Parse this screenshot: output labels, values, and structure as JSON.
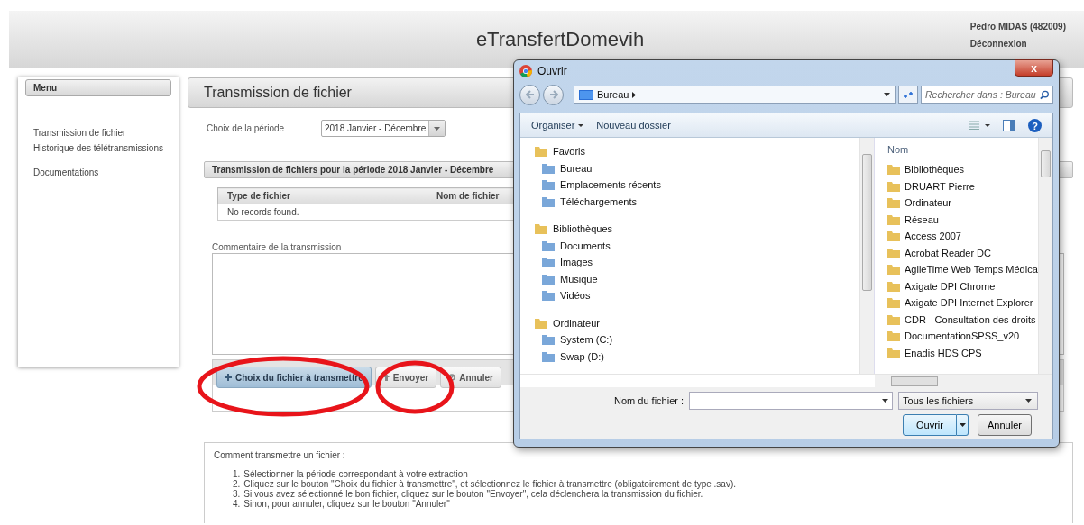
{
  "header": {
    "title": "eTransfertDomevih",
    "user": "Pedro MIDAS (482009)",
    "logout": "Déconnexion"
  },
  "sidebar": {
    "title": "Menu",
    "items": [
      {
        "label": "Transmission de fichier"
      },
      {
        "label": "Historique des télétransmissions"
      },
      {
        "label": "Documentations"
      }
    ]
  },
  "main": {
    "title": "Transmission de fichier",
    "period_label": "Choix de la période",
    "period_value": "2018 Janvier - Décembre",
    "section_title": "Transmission de fichiers pour la période 2018 Janvier - Décembre",
    "table": {
      "columns": [
        "Type de fichier",
        "Nom de fichier"
      ],
      "empty": "No records found."
    },
    "comment_label": "Commentaire de la transmission",
    "buttons": [
      {
        "label": "Choix du fichier à transmettre",
        "kind": "add",
        "highlighted": true
      },
      {
        "label": "Envoyer",
        "kind": "upload",
        "highlighted": true
      },
      {
        "label": "Annuler",
        "kind": "cancel",
        "highlighted": false
      }
    ],
    "help": {
      "title": "Comment transmettre un fichier :",
      "steps": [
        {
          "number": "1.",
          "text": "Sélectionner la période correspondant à votre extraction"
        },
        {
          "number": "2.",
          "text": "Cliquez sur le bouton \"Choix du fichier à transmettre\", et sélectionnez le fichier à transmettre (obligatoirement de type .sav)."
        },
        {
          "number": "3.",
          "text": "Si vous avez sélectionné le bon fichier, cliquez sur le bouton \"Envoyer\", cela déclenchera la transmission du fichier."
        },
        {
          "number": "4.",
          "text": "Sinon, pour annuler, cliquez sur le bouton \"Annuler\""
        }
      ]
    }
  },
  "dialog": {
    "title": "Ouvrir",
    "close": "x",
    "path": "Bureau",
    "search_placeholder": "Rechercher dans : Bureau",
    "toolbar": [
      "Organiser",
      "Nouveau dossier"
    ],
    "help": "?",
    "nav": [
      {
        "label": "Favoris",
        "children": [
          {
            "label": "Bureau"
          },
          {
            "label": "Emplacements récents"
          },
          {
            "label": "Téléchargements"
          }
        ]
      },
      {
        "label": "Bibliothèques",
        "children": [
          {
            "label": "Documents"
          },
          {
            "label": "Images"
          },
          {
            "label": "Musique"
          },
          {
            "label": "Vidéos"
          }
        ]
      },
      {
        "label": "Ordinateur",
        "children": [
          {
            "label": "System (C:)"
          },
          {
            "label": "Swap (D:)"
          }
        ]
      }
    ],
    "column": "Nom",
    "files": [
      "Bibliothèques",
      "DRUART Pierre",
      "Ordinateur",
      "Réseau",
      "Access 2007",
      "Acrobat Reader DC",
      "AgileTime Web Temps Médica",
      "Axigate DPI Chrome",
      "Axigate DPI Internet Explorer",
      "CDR - Consultation des droits",
      "DocumentationSPSS_v20",
      "Enadis HDS CPS"
    ],
    "filename_label": "Nom du fichier :",
    "filter": "Tous les fichiers",
    "open": "Ouvrir",
    "cancel": "Annuler"
  }
}
